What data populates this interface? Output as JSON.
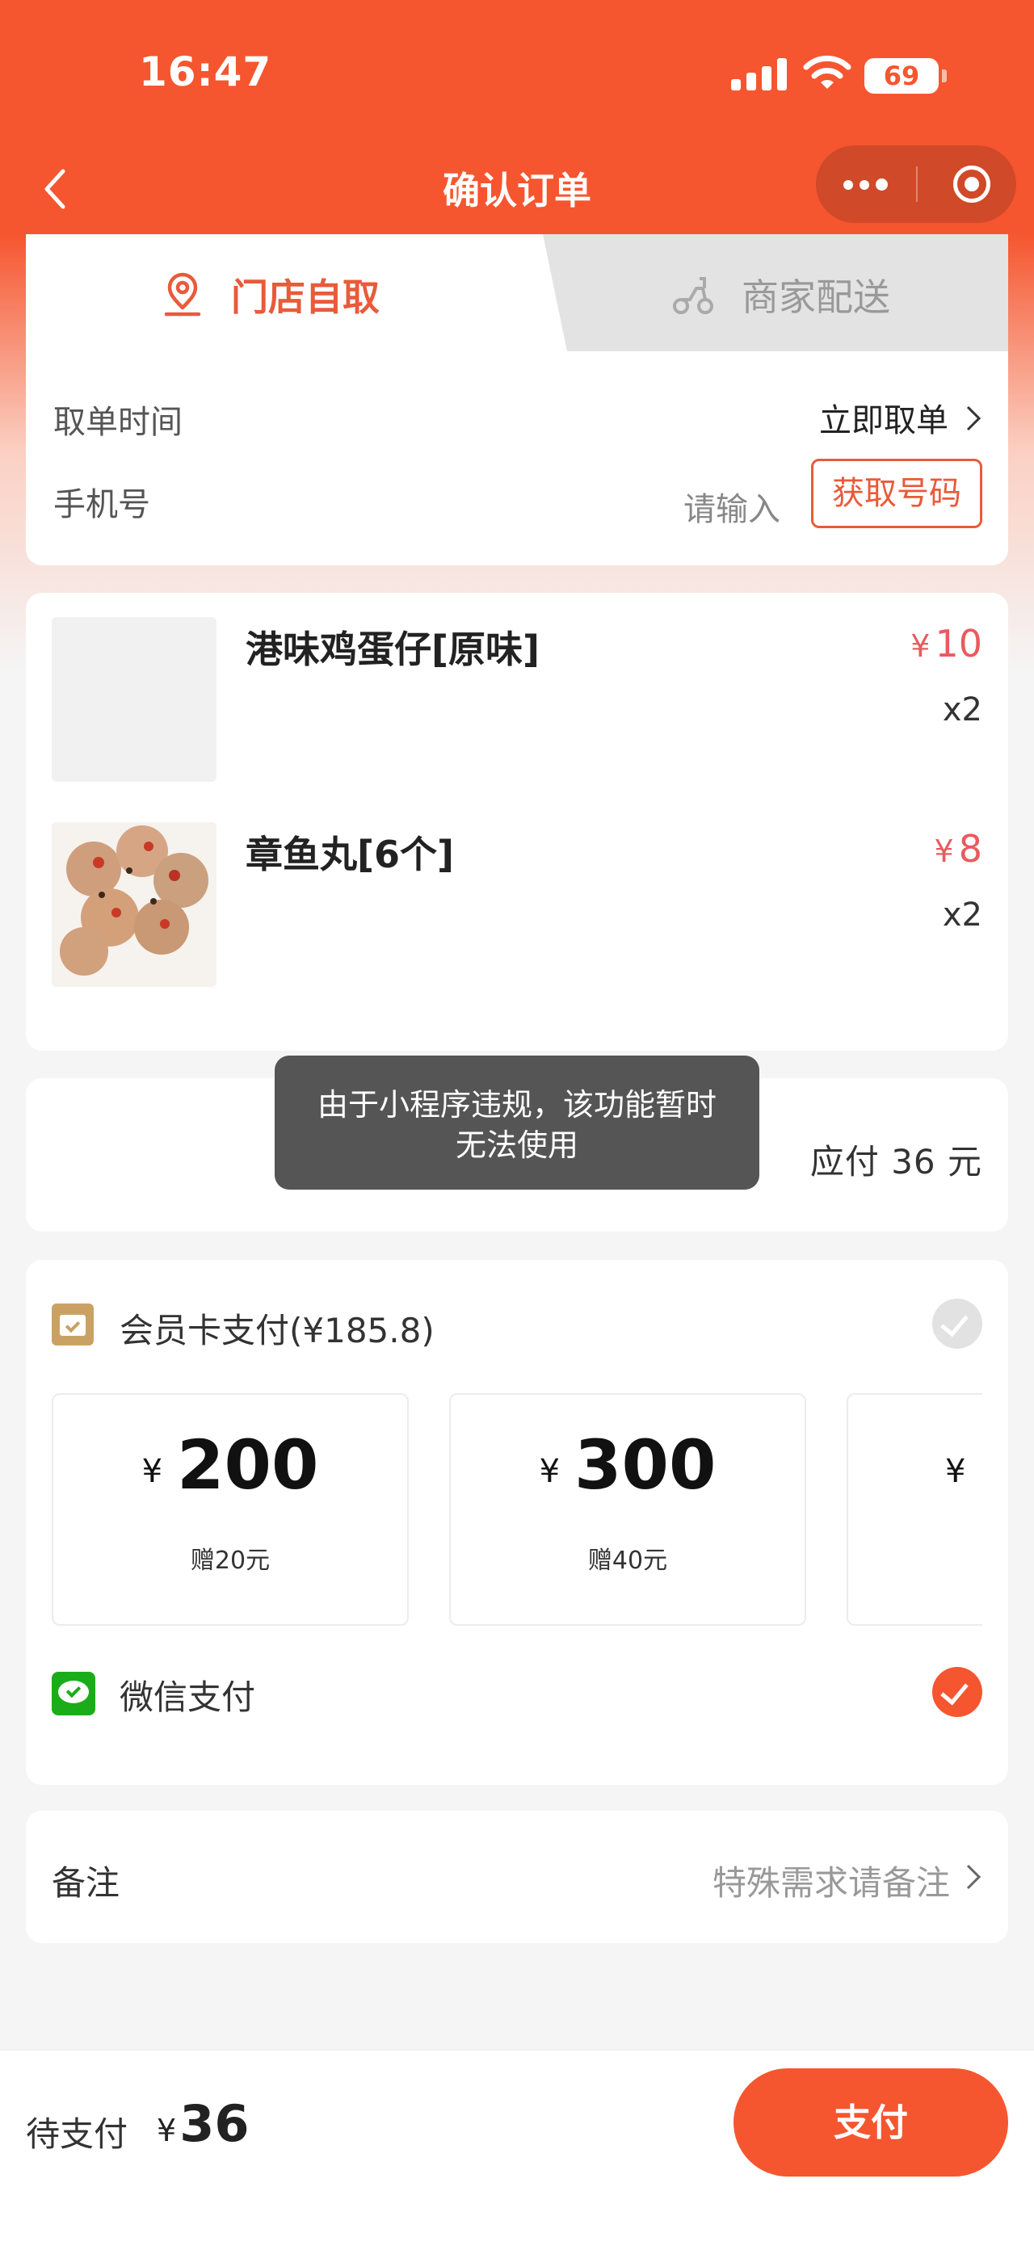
{
  "status_bar": {
    "time": "16:47",
    "battery": "69"
  },
  "nav": {
    "title": "确认订单"
  },
  "tabs": {
    "pickup": "门店自取",
    "delivery": "商家配送"
  },
  "order_info": {
    "pickup_time_label": "取单时间",
    "pickup_time_value": "立即取单",
    "phone_label": "手机号",
    "phone_placeholder": "请输入",
    "get_number_button": "获取号码"
  },
  "goods": [
    {
      "name": "港味鸡蛋仔[原味]",
      "currency": "¥",
      "price": "10",
      "qty": "x2"
    },
    {
      "name": "章鱼丸[6个]",
      "currency": "¥",
      "price": "8",
      "qty": "x2"
    }
  ],
  "total": {
    "text": "应付 36 元"
  },
  "toast": {
    "text": "由于小程序违规，该功能暂时无法使用"
  },
  "payment": {
    "member_label": "会员卡支付(¥185.8)",
    "recharge_options": [
      {
        "currency": "¥",
        "amount": "200",
        "bonus": "赠20元"
      },
      {
        "currency": "¥",
        "amount": "300",
        "bonus": "赠40元"
      },
      {
        "currency": "¥",
        "amount": "",
        "bonus": ""
      }
    ],
    "wechat_label": "微信支付"
  },
  "remark": {
    "label": "备注",
    "hint": "特殊需求请备注"
  },
  "bottom": {
    "pending_label": "待支付",
    "currency": "¥",
    "amount": "36",
    "pay_button": "支付"
  },
  "colors": {
    "brand": "#f5562f",
    "price": "#ea5a5f",
    "wechat": "#1aad19",
    "member": "#c9a263"
  }
}
